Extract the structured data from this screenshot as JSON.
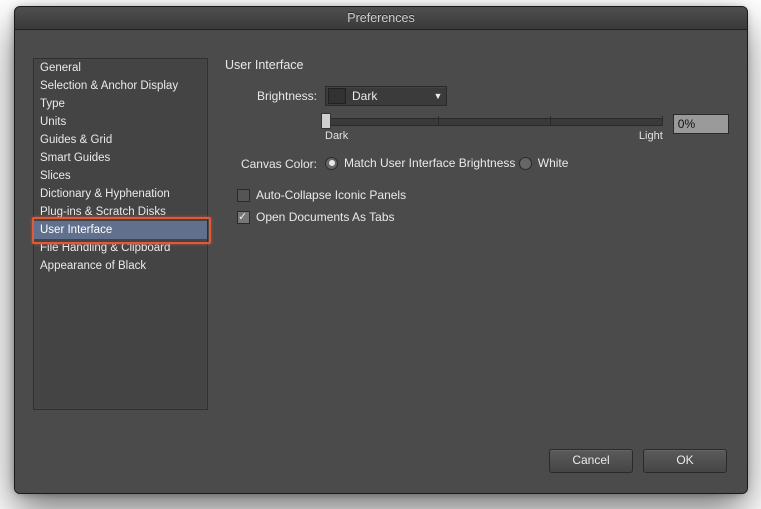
{
  "title": "Preferences",
  "sidebar": {
    "items": [
      {
        "label": "General"
      },
      {
        "label": "Selection & Anchor Display"
      },
      {
        "label": "Type"
      },
      {
        "label": "Units"
      },
      {
        "label": "Guides & Grid"
      },
      {
        "label": "Smart Guides"
      },
      {
        "label": "Slices"
      },
      {
        "label": "Dictionary & Hyphenation"
      },
      {
        "label": "Plug-ins & Scratch Disks"
      },
      {
        "label": "User Interface"
      },
      {
        "label": "File Handling & Clipboard"
      },
      {
        "label": "Appearance of Black"
      }
    ],
    "selected_index": 9
  },
  "panel": {
    "title": "User Interface",
    "brightness": {
      "label": "Brightness:",
      "value": "Dark",
      "slider": {
        "min_label": "Dark",
        "max_label": "Light",
        "percent_text": "0%",
        "position": 0
      }
    },
    "canvas_color": {
      "label": "Canvas Color:",
      "options": [
        {
          "label": "Match User Interface Brightness",
          "checked": true
        },
        {
          "label": "White",
          "checked": false
        }
      ]
    },
    "auto_collapse": {
      "label": "Auto-Collapse Iconic Panels",
      "checked": false
    },
    "open_as_tabs": {
      "label": "Open Documents As Tabs",
      "checked": true
    }
  },
  "footer": {
    "cancel": "Cancel",
    "ok": "OK"
  }
}
